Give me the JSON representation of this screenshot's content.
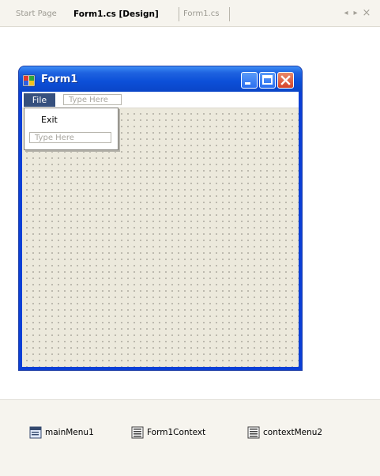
{
  "tabs": [
    {
      "label": "Start Page"
    },
    {
      "label": "Form1.cs [Design]"
    },
    {
      "label": "Form1.cs"
    }
  ],
  "tab_controls": {
    "scroll_left": "◂",
    "scroll_right": "▸",
    "close": "×"
  },
  "form": {
    "title": "Form1",
    "menu": {
      "file_label": "File",
      "type_here": "Type Here",
      "dropdown": {
        "exit_label": "Exit",
        "type_here": "Type Here"
      }
    }
  },
  "tray": {
    "components": [
      {
        "label": "mainMenu1",
        "icon": "main-menu-icon"
      },
      {
        "label": "Form1Context",
        "icon": "context-menu-icon"
      },
      {
        "label": "contextMenu2",
        "icon": "context-menu-icon"
      }
    ]
  },
  "colors": {
    "titlebar": "#0c4fd8",
    "menu_selected": "#36507e",
    "designer_surface": "#ece9dc",
    "close_button": "#d6432a"
  }
}
